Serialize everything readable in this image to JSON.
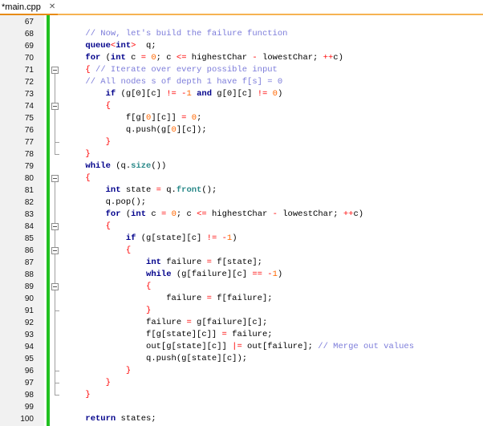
{
  "tab": {
    "label": "*main.cpp",
    "close": "✕"
  },
  "lines": [
    {
      "n": "67",
      "code": []
    },
    {
      "n": "68",
      "code": [
        [
          "c",
          "        // Now, let's build the failure function"
        ]
      ]
    },
    {
      "n": "69",
      "code": [
        [
          "k",
          "        queue"
        ],
        [
          "o",
          "<"
        ],
        [
          "k",
          "int"
        ],
        [
          "o",
          ">"
        ],
        [
          "",
          "  q;"
        ]
      ]
    },
    {
      "n": "70",
      "code": [
        [
          "k",
          "        for"
        ],
        [
          "",
          " ("
        ],
        [
          "k",
          "int"
        ],
        [
          "",
          " c "
        ],
        [
          "o",
          "="
        ],
        [
          "",
          " "
        ],
        [
          "n",
          "0"
        ],
        [
          "",
          "; c "
        ],
        [
          "o",
          "<="
        ],
        [
          "",
          " highestChar "
        ],
        [
          "o",
          "-"
        ],
        [
          "",
          " lowestChar; "
        ],
        [
          "o",
          "++"
        ],
        [
          "",
          "c)"
        ]
      ]
    },
    {
      "n": "71",
      "code": [
        [
          "o",
          "        {"
        ],
        [
          "c",
          " // Iterate over every possible input"
        ]
      ]
    },
    {
      "n": "72",
      "code": [
        [
          "c",
          "        // All nodes s of depth 1 have f[s] = 0"
        ]
      ]
    },
    {
      "n": "73",
      "code": [
        [
          "k",
          "            if"
        ],
        [
          "",
          " (g[0][c] "
        ],
        [
          "o",
          "!="
        ],
        [
          "",
          " "
        ],
        [
          "o",
          "-"
        ],
        [
          "n",
          "1"
        ],
        [
          "",
          " "
        ],
        [
          "k",
          "and"
        ],
        [
          "",
          " g[0][c] "
        ],
        [
          "o",
          "!="
        ],
        [
          "",
          " "
        ],
        [
          "n",
          "0"
        ],
        [
          "",
          ")"
        ]
      ]
    },
    {
      "n": "74",
      "code": [
        [
          "o",
          "            {"
        ]
      ]
    },
    {
      "n": "75",
      "code": [
        [
          "",
          "                f[g["
        ],
        [
          "n",
          "0"
        ],
        [
          "",
          "][c]] "
        ],
        [
          "o",
          "="
        ],
        [
          "",
          " "
        ],
        [
          "n",
          "0"
        ],
        [
          "",
          ";"
        ]
      ]
    },
    {
      "n": "76",
      "code": [
        [
          "",
          "                q.push(g["
        ],
        [
          "n",
          "0"
        ],
        [
          "",
          "][c]);"
        ]
      ]
    },
    {
      "n": "77",
      "code": [
        [
          "o",
          "            }"
        ]
      ]
    },
    {
      "n": "78",
      "code": [
        [
          "o",
          "        }"
        ]
      ]
    },
    {
      "n": "79",
      "code": [
        [
          "k",
          "        while"
        ],
        [
          "",
          " (q."
        ],
        [
          "fn",
          "size"
        ],
        [
          "",
          "())"
        ]
      ]
    },
    {
      "n": "80",
      "code": [
        [
          "o",
          "        {"
        ]
      ]
    },
    {
      "n": "81",
      "code": [
        [
          "k",
          "            int"
        ],
        [
          "",
          " state "
        ],
        [
          "o",
          "="
        ],
        [
          "",
          " q."
        ],
        [
          "fn",
          "front"
        ],
        [
          "",
          "();"
        ]
      ]
    },
    {
      "n": "82",
      "code": [
        [
          "",
          "            q.pop();"
        ]
      ]
    },
    {
      "n": "83",
      "code": [
        [
          "k",
          "            for"
        ],
        [
          "",
          " ("
        ],
        [
          "k",
          "int"
        ],
        [
          "",
          " c "
        ],
        [
          "o",
          "="
        ],
        [
          "",
          " "
        ],
        [
          "n",
          "0"
        ],
        [
          "",
          "; c "
        ],
        [
          "o",
          "<="
        ],
        [
          "",
          " highestChar "
        ],
        [
          "o",
          "-"
        ],
        [
          "",
          " lowestChar; "
        ],
        [
          "o",
          "++"
        ],
        [
          "",
          "c)"
        ]
      ]
    },
    {
      "n": "84",
      "code": [
        [
          "o",
          "            {"
        ]
      ]
    },
    {
      "n": "85",
      "code": [
        [
          "k",
          "                if"
        ],
        [
          "",
          " (g[state][c] "
        ],
        [
          "o",
          "!="
        ],
        [
          "",
          " "
        ],
        [
          "o",
          "-"
        ],
        [
          "n",
          "1"
        ],
        [
          "",
          ")"
        ]
      ]
    },
    {
      "n": "86",
      "code": [
        [
          "o",
          "                {"
        ]
      ]
    },
    {
      "n": "87",
      "code": [
        [
          "k",
          "                    int"
        ],
        [
          "",
          " failure "
        ],
        [
          "o",
          "="
        ],
        [
          "",
          " f[state];"
        ]
      ]
    },
    {
      "n": "88",
      "code": [
        [
          "k",
          "                    while"
        ],
        [
          "",
          " (g[failure][c] "
        ],
        [
          "o",
          "=="
        ],
        [
          "",
          " "
        ],
        [
          "o",
          "-"
        ],
        [
          "n",
          "1"
        ],
        [
          "",
          ")"
        ]
      ]
    },
    {
      "n": "89",
      "code": [
        [
          "o",
          "                    {"
        ]
      ]
    },
    {
      "n": "90",
      "code": [
        [
          "",
          "                        failure "
        ],
        [
          "o",
          "="
        ],
        [
          "",
          " f[failure];"
        ]
      ]
    },
    {
      "n": "91",
      "code": [
        [
          "o",
          "                    }"
        ]
      ]
    },
    {
      "n": "92",
      "code": [
        [
          "",
          "                    failure "
        ],
        [
          "o",
          "="
        ],
        [
          "",
          " g[failure][c];"
        ]
      ]
    },
    {
      "n": "93",
      "code": [
        [
          "",
          "                    f[g[state][c]] "
        ],
        [
          "o",
          "="
        ],
        [
          "",
          " failure;"
        ]
      ]
    },
    {
      "n": "94",
      "code": [
        [
          "",
          "                    out[g[state][c]] "
        ],
        [
          "o",
          "|="
        ],
        [
          "",
          " out[failure];"
        ],
        [
          "c",
          " // Merge out values"
        ]
      ]
    },
    {
      "n": "95",
      "code": [
        [
          "",
          "                    q.push(g[state][c]);"
        ]
      ]
    },
    {
      "n": "96",
      "code": [
        [
          "o",
          "                }"
        ]
      ]
    },
    {
      "n": "97",
      "code": [
        [
          "o",
          "            }"
        ]
      ]
    },
    {
      "n": "98",
      "code": [
        [
          "o",
          "        }"
        ]
      ]
    },
    {
      "n": "99",
      "code": []
    },
    {
      "n": "100",
      "code": [
        [
          "k",
          "        return"
        ],
        [
          "",
          " states;"
        ]
      ]
    }
  ]
}
